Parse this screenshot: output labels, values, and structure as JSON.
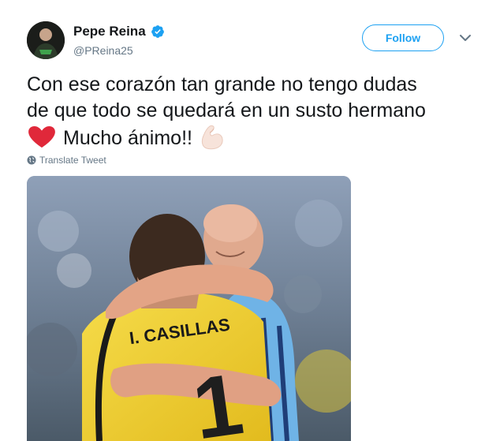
{
  "tweet": {
    "display_name": "Pepe Reina",
    "handle": "@PReina25",
    "follow_label": "Follow",
    "text_lines": [
      "Con ese corazón tan grande no tengo dudas",
      "de que todo se quedará en un susto hermano",
      "Mucho ánimo!!"
    ],
    "translate_label": "Translate Tweet",
    "photo_jersey_text": "I. CASILLAS",
    "photo_jersey_number": "1"
  },
  "icons": {
    "verified": "verified-badge-icon",
    "chevron": "chevron-down-icon",
    "globe": "globe-icon",
    "heart": "red-heart-emoji",
    "muscle": "flexed-biceps-emoji"
  },
  "colors": {
    "accent": "#1da1f2",
    "text": "#14171a",
    "secondary": "#657786",
    "heart": "#e0283a",
    "jersey": "#f2d23a",
    "shirt_blue": "#6fb3e6"
  }
}
